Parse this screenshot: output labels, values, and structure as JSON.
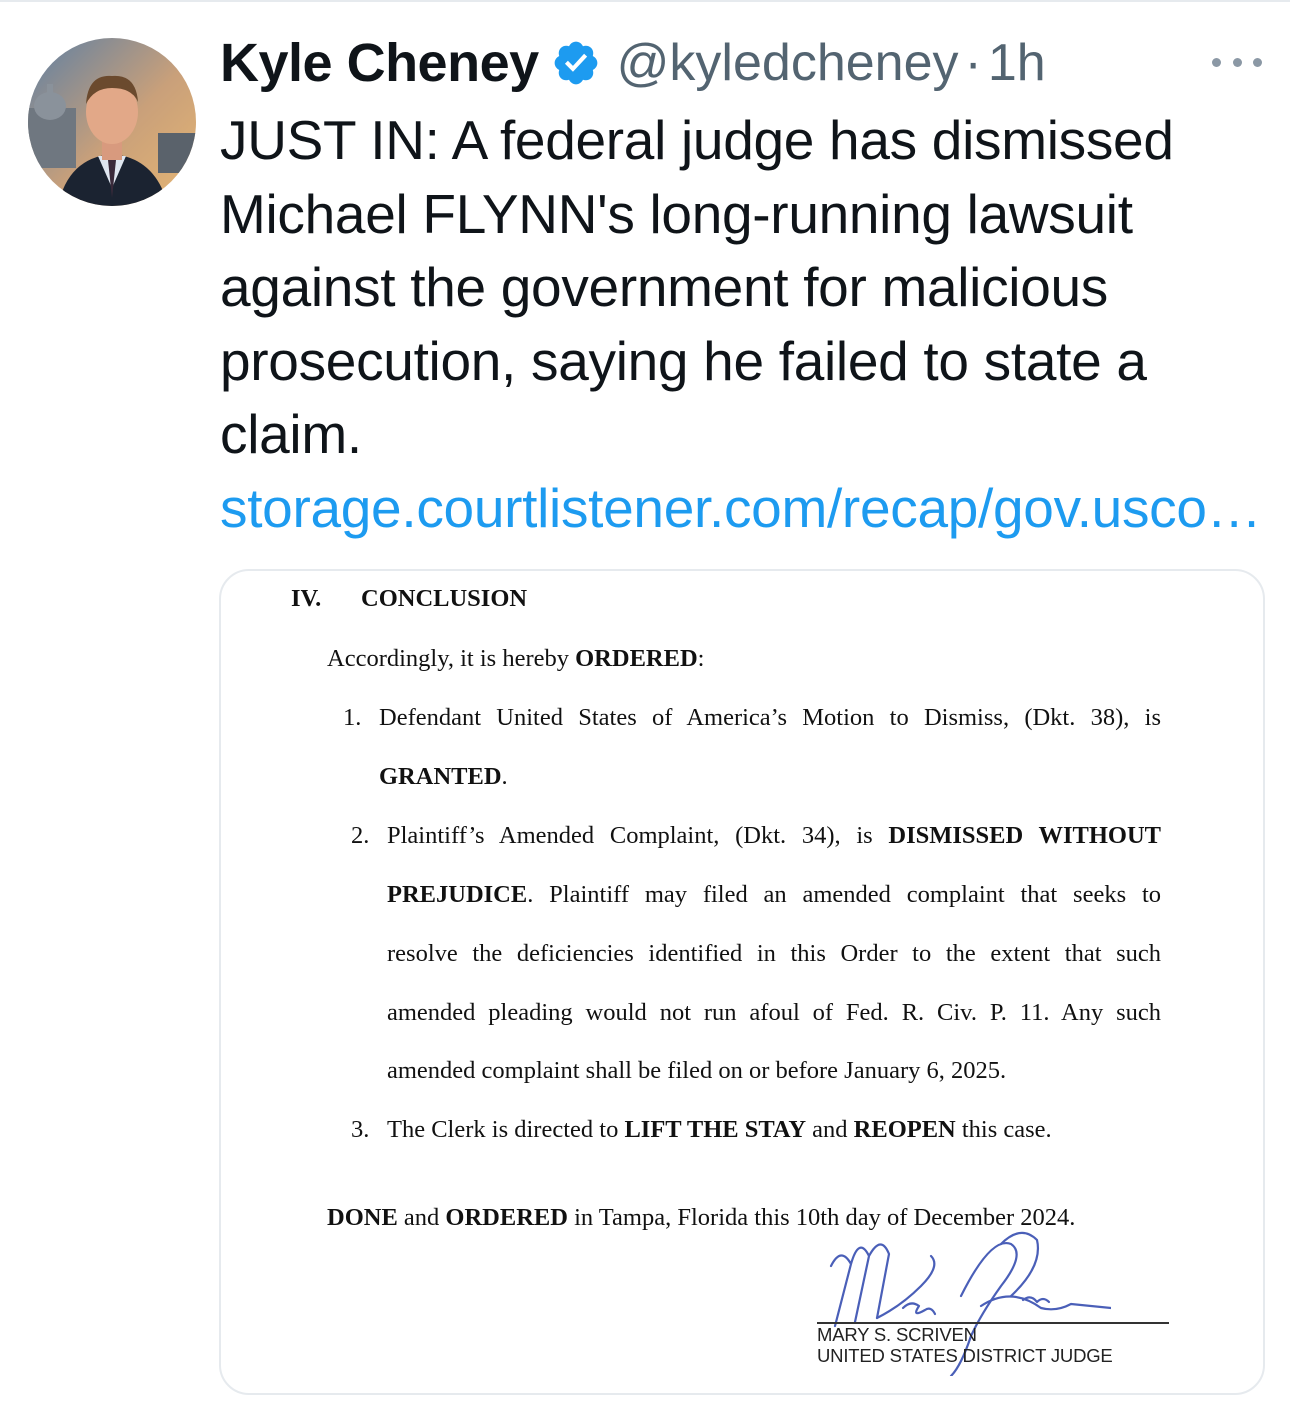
{
  "tweet": {
    "author_name": "Kyle Cheney",
    "handle": "@kyledcheney",
    "separator": "·",
    "time": "1h",
    "text": "JUST IN:  A federal judge has dismissed Michael FLYNN's long-running lawsuit against the government for malicious prosecution, saying he failed to state a claim. ",
    "link_text": "storage.courtlistener.com/recap/gov.usco…"
  },
  "icons": {
    "verified": "verified-badge-icon",
    "more": "more-options-icon"
  },
  "colors": {
    "link": "#1d9bf0",
    "verified": "#1d9bf0",
    "secondary_text": "#536471"
  },
  "document": {
    "section_number": "IV.",
    "section_title": "CONCLUSION",
    "intro_pre": "Accordingly, it is hereby ",
    "intro_bold": "ORDERED",
    "intro_post": ":",
    "item1_num": "1.",
    "item1_line1": "Defendant United States of America’s Motion to Dismiss, (Dkt. 38), is",
    "item1_line2_bold": "GRANTED",
    "item1_line2_post": ".",
    "item2_num": "2.",
    "item2_line1_pre": "Plaintiff’s Amended Complaint, (Dkt. 34), is ",
    "item2_line1_bold": "DISMISSED WITHOUT",
    "item2_line2_bold": "PREJUDICE",
    "item2_line2_post": ". Plaintiff may filed an amended complaint that seeks to",
    "item2_line3": "resolve the deficiencies identified in this Order to the extent that such",
    "item2_line4": "amended pleading would not run afoul of Fed. R. Civ. P. 11.  Any such",
    "item2_line5": "amended complaint shall be filed on or before January 6, 2025.",
    "item3_num": "3.",
    "item3_pre": "The Clerk is directed to ",
    "item3_bold1": "LIFT THE STAY",
    "item3_mid": " and ",
    "item3_bold2": "REOPEN",
    "item3_post": " this case.",
    "done_bold1": "DONE",
    "done_mid": " and ",
    "done_bold2": "ORDERED",
    "done_post": " in Tampa, Florida this 10th day of December 2024.",
    "judge_name": "MARY S. SCRIVEN",
    "judge_title": "UNITED STATES DISTRICT JUDGE"
  }
}
